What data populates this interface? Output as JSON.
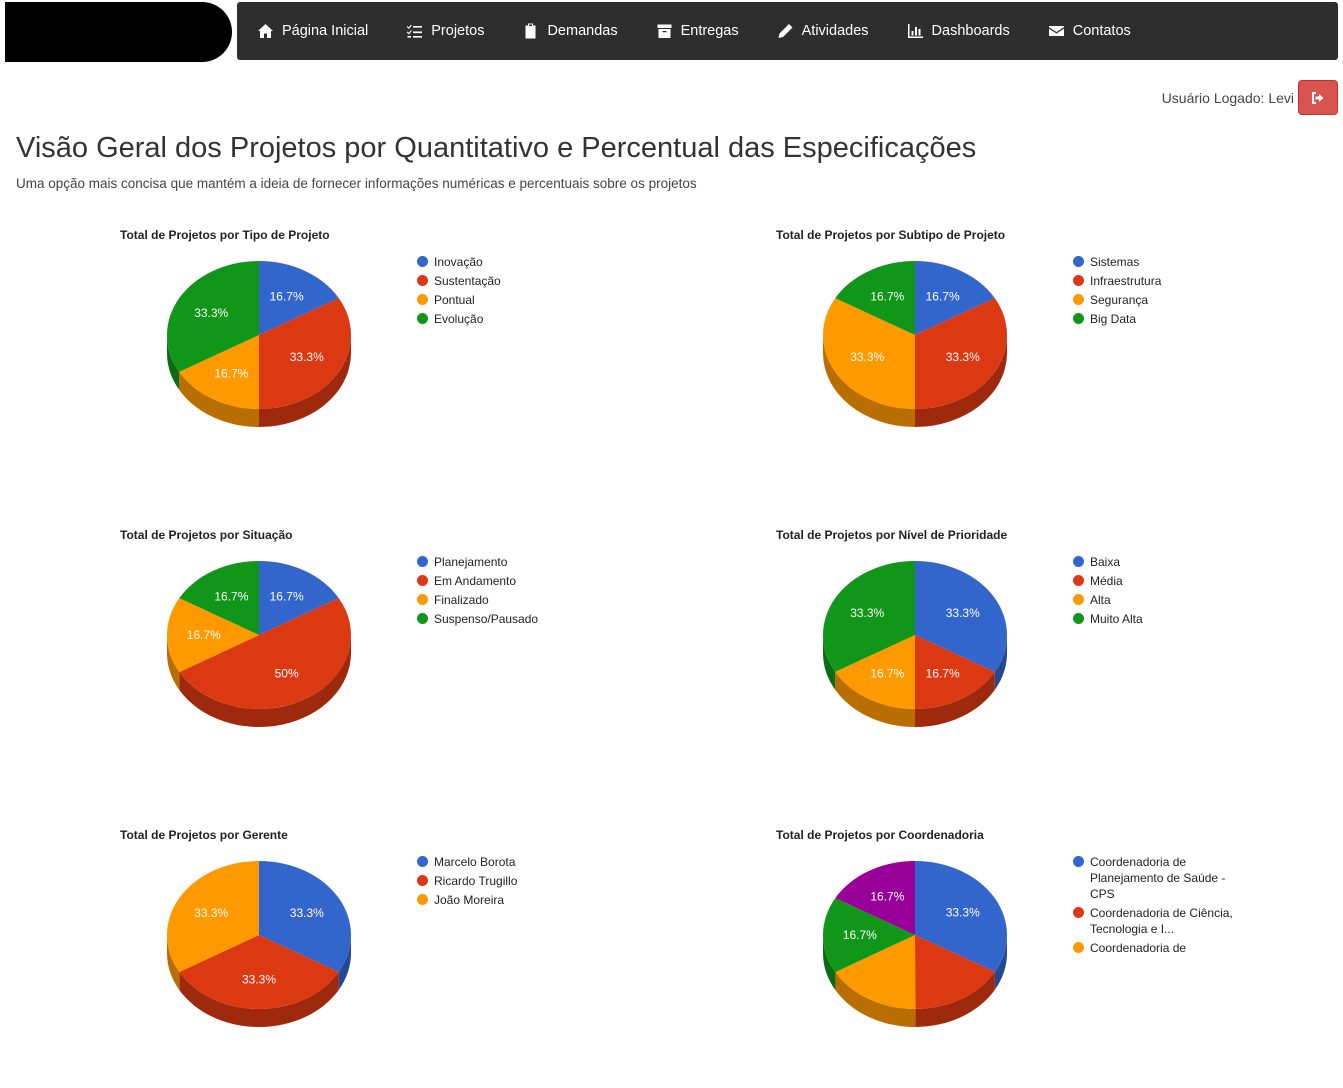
{
  "nav": {
    "items": [
      {
        "label": "Página Inicial",
        "icon": "home-icon"
      },
      {
        "label": "Projetos",
        "icon": "tasks-icon"
      },
      {
        "label": "Demandas",
        "icon": "clipboard-icon"
      },
      {
        "label": "Entregas",
        "icon": "archive-icon"
      },
      {
        "label": "Atividades",
        "icon": "pencil-icon"
      },
      {
        "label": "Dashboards",
        "icon": "bar-chart-icon"
      },
      {
        "label": "Contatos",
        "icon": "envelope-icon"
      }
    ]
  },
  "user": {
    "label": "Usuário Logado: Levi",
    "logout_icon": "sign-out-icon"
  },
  "page": {
    "title": "Visão Geral dos Projetos por Quantitativo e Percentual das Especificações",
    "subtitle": "Uma opção mais concisa que mantém a ideia de fornecer informações numéricas e percentuais sobre os projetos"
  },
  "colors": {
    "blue": "#3366cc",
    "red": "#dc3912",
    "orange": "#ff9900",
    "green": "#109618",
    "purple": "#990099",
    "navbar": "#2e2e2e",
    "logout": "#d9534f"
  },
  "chart_data": [
    {
      "type": "pie",
      "title": "Total de Projetos por Tipo de Projeto",
      "categories": [
        "Inovação",
        "Sustentação",
        "Pontual",
        "Evolução"
      ],
      "values": [
        16.7,
        33.3,
        16.7,
        33.3
      ],
      "labels": [
        "16.7%",
        "33.3%",
        "16.7%",
        "33.3%"
      ],
      "colors": [
        "#3366cc",
        "#dc3912",
        "#ff9900",
        "#109618"
      ],
      "legend": "right"
    },
    {
      "type": "pie",
      "title": "Total de Projetos por Subtipo de Projeto",
      "categories": [
        "Sistemas",
        "Infraestrutura",
        "Segurança",
        "Big Data"
      ],
      "values": [
        16.7,
        33.3,
        33.3,
        16.7
      ],
      "labels": [
        "16.7%",
        "33.3%",
        "33.3%",
        "16.7%"
      ],
      "colors": [
        "#3366cc",
        "#dc3912",
        "#ff9900",
        "#109618"
      ],
      "legend": "right"
    },
    {
      "type": "pie",
      "title": "Total de Projetos por Situação",
      "categories": [
        "Planejamento",
        "Em Andamento",
        "Finalizado",
        "Suspenso/Pausado"
      ],
      "values": [
        16.7,
        50,
        16.7,
        16.7
      ],
      "labels": [
        "16.7%",
        "50%",
        "16.7%",
        "16.7%"
      ],
      "colors": [
        "#3366cc",
        "#dc3912",
        "#ff9900",
        "#109618"
      ],
      "legend": "right"
    },
    {
      "type": "pie",
      "title": "Total de Projetos por Nível de Prioridade",
      "categories": [
        "Baixa",
        "Média",
        "Alta",
        "Muito Alta"
      ],
      "values": [
        33.3,
        16.7,
        16.7,
        33.3
      ],
      "labels": [
        "33.3%",
        "16.7%",
        "16.7%",
        "33.3%"
      ],
      "colors": [
        "#3366cc",
        "#dc3912",
        "#ff9900",
        "#109618"
      ],
      "legend": "right"
    },
    {
      "type": "pie",
      "title": "Total de Projetos por Gerente",
      "categories": [
        "Marcelo Borota",
        "Ricardo Trugillo",
        "João Moreira"
      ],
      "values": [
        33.3,
        33.3,
        33.3
      ],
      "labels": [
        "33.3%",
        "33.3%",
        "33.3%"
      ],
      "colors": [
        "#3366cc",
        "#dc3912",
        "#ff9900"
      ],
      "legend": "right"
    },
    {
      "type": "pie",
      "title": "Total de Projetos por Coordenadoria",
      "categories": [
        "Coordenadoria de Planejamento de Saúde - CPS",
        "Coordenadoria de Ciência, Tecnologia e I...",
        "Coordenadoria de"
      ],
      "values": [
        33.3,
        16.7,
        16.7,
        16.7,
        16.7
      ],
      "labels": [
        "33.3%",
        "",
        "",
        "16.7%",
        "16.7%"
      ],
      "colors": [
        "#3366cc",
        "#dc3912",
        "#ff9900",
        "#109618",
        "#990099"
      ],
      "legend": "right"
    }
  ]
}
